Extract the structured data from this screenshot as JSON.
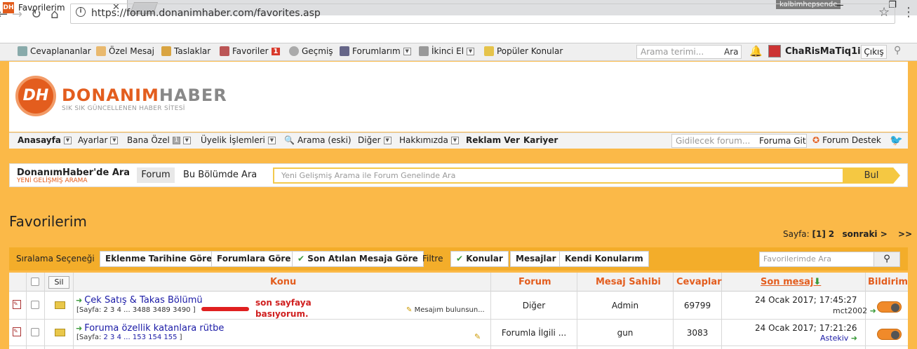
{
  "browser": {
    "tab_title": "Favorilerim",
    "favicon_text": "DH",
    "profile": "kalbimhepsende",
    "url_scheme": "https://",
    "url_host": "forum.donanimhaber.com",
    "url_path": "/favorites.asp"
  },
  "topbar": {
    "items": [
      {
        "label": "Cevaplananlar",
        "icon": "reply-icon"
      },
      {
        "label": "Özel Mesaj",
        "icon": "envelope-icon"
      },
      {
        "label": "Taslaklar",
        "icon": "draft-icon"
      },
      {
        "label": "Favoriler",
        "icon": "heart-icon",
        "badge": "1"
      },
      {
        "label": "Geçmiş",
        "icon": "history-icon"
      },
      {
        "label": "Forumlarım",
        "icon": "forums-icon"
      },
      {
        "label": "İkinci El",
        "icon": "cart-icon"
      },
      {
        "label": "Popüler Konular",
        "icon": "popular-icon"
      }
    ],
    "search_placeholder": "Arama terimi...",
    "search_button": "Ara",
    "username": "ChaRisMaTiq1i",
    "logout": "Çıkış"
  },
  "logo": {
    "mark": "DH",
    "name_a": "DONANIM",
    "name_b": "HABER",
    "tagline": "SIK SIK GÜNCELLENEN HABER SİTESİ"
  },
  "mainnav": {
    "items": [
      "Anasayfa",
      "Ayarlar",
      "Bana Özel",
      "Üyelik İşlemleri",
      "Arama (eski)",
      "Diğer",
      "Hakkımızda",
      "Reklam Ver",
      "Kariyer"
    ],
    "bana_ozel_badge": "1",
    "goto_placeholder": "Gidilecek forum...",
    "goto_button": "Foruma Git",
    "support": "Forum Destek"
  },
  "searchbar": {
    "title": "DonanımHaber'de Ara",
    "subtitle": "YENİ GELİŞMİŞ ARAMA",
    "forum": "Forum",
    "section": "Bu Bölümde Ara",
    "placeholder": "Yeni Gelişmiş Arama ile Forum Genelinde Ara",
    "button": "Bul"
  },
  "page": {
    "title": "Favorilerim",
    "pager_label": "Sayfa:",
    "pager_current": "[1]",
    "pager_next_page": "2",
    "pager_next": "sonraki >",
    "pager_last": ">>"
  },
  "sortbar": {
    "label": "Sıralama Seçeneği",
    "sort_added": "Eklenme Tarihine Göre",
    "sort_forum": "Forumlara Göre",
    "sort_last": "Son Atılan Mesaja Göre",
    "filter_label": "Filtre",
    "filter_topics": "Konular",
    "filter_messages": "Mesajlar",
    "filter_own": "Kendi Konularım",
    "fav_search_placeholder": "Favorilerimde Ara"
  },
  "table": {
    "delete": "Sil",
    "headers": {
      "topic": "Konu",
      "forum": "Forum",
      "owner": "Mesaj Sahibi",
      "replies": "Cevaplar",
      "last": "Son mesaj",
      "notify": "Bildirim"
    },
    "rows": [
      {
        "title": "Çek Satış & Takas Bölümü",
        "pages_prefix": "[Sayfa:",
        "pages": "2 3 4 ... 3488 3489 3490",
        "pages_suffix": "]",
        "note": "Mesajım bulunsun...",
        "forum": "Diğer",
        "owner": "Admin",
        "replies": "69799",
        "last_date": "24 Ocak 2017; 17:45:27",
        "last_user": "mct2002"
      },
      {
        "title": "Foruma özellik katanlara rütbe",
        "pages_prefix": "[Sayfa:",
        "pages": "2 3 4 ... 153 154 155",
        "pages_suffix": "]",
        "note": "",
        "forum": "Forumla İlgili ...",
        "owner": "gun",
        "replies": "3083",
        "last_date": "24 Ocak 2017; 17:21:26",
        "last_user": "Astekiv"
      }
    ]
  },
  "annotation": {
    "line1": "son sayfaya",
    "line2": "basıyorum."
  }
}
